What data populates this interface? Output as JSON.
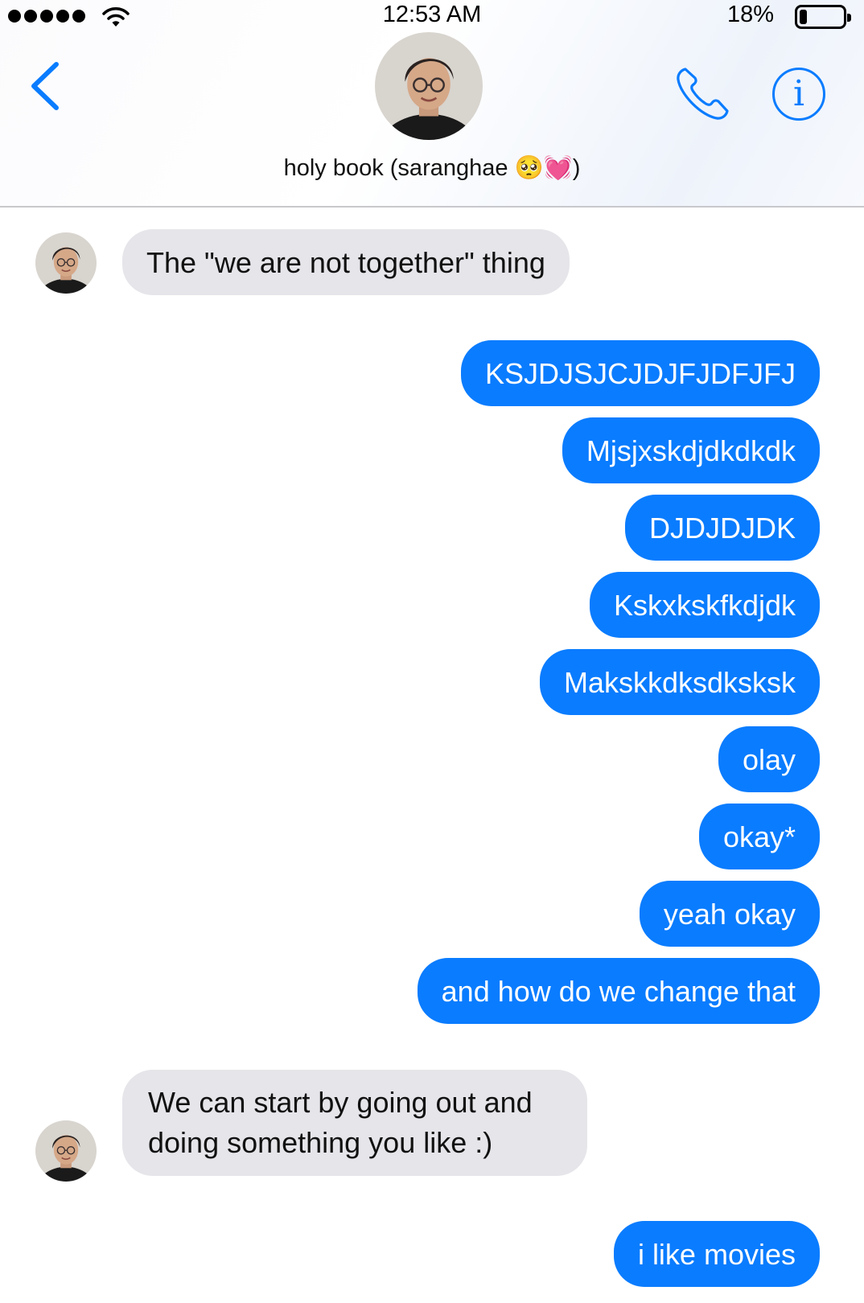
{
  "status_bar": {
    "time": "12:53 AM",
    "battery_percent": "18%",
    "battery_level": 0.18,
    "signal_bars": 5
  },
  "header": {
    "contact_name": "holy book (saranghae 🥺💓)",
    "info_label": "i",
    "accent_color": "#0a7cff"
  },
  "messages": [
    {
      "direction": "incoming",
      "text": "The \"we are not together\" thing"
    },
    {
      "direction": "outgoing",
      "text": "KSJDJSJCJDJFJDFJFJ"
    },
    {
      "direction": "outgoing",
      "text": "Mjsjxskdjdkdkdk"
    },
    {
      "direction": "outgoing",
      "text": "DJDJDJDK"
    },
    {
      "direction": "outgoing",
      "text": "Kskxkskfkdjdk"
    },
    {
      "direction": "outgoing",
      "text": "Makskkdksdksksk"
    },
    {
      "direction": "outgoing",
      "text": "olay"
    },
    {
      "direction": "outgoing",
      "text": "okay*"
    },
    {
      "direction": "outgoing",
      "text": "yeah okay"
    },
    {
      "direction": "outgoing",
      "text": "and how do we change that"
    },
    {
      "direction": "incoming",
      "text": "We can start by going out and doing something you like :)"
    },
    {
      "direction": "outgoing",
      "text": "i like movies"
    }
  ],
  "colors": {
    "outgoing_bubble": "#0a7cff",
    "incoming_bubble": "#e5e5ea"
  }
}
